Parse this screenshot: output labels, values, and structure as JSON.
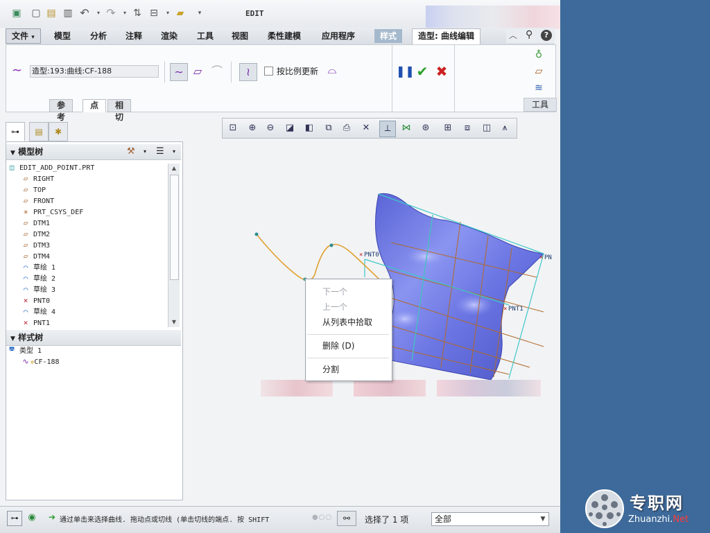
{
  "window": {
    "title": "EDIT"
  },
  "menu": {
    "tabs": [
      {
        "label": "文件",
        "dropdown": "▾"
      },
      {
        "label": "模型"
      },
      {
        "label": "分析"
      },
      {
        "label": "注释"
      },
      {
        "label": "渲染"
      },
      {
        "label": "工具"
      },
      {
        "label": "视图"
      },
      {
        "label": "柔性建模"
      },
      {
        "label": "应用程序"
      },
      {
        "label": "样式"
      },
      {
        "label": "造型: 曲线编辑"
      }
    ]
  },
  "ribbon": {
    "curve_name": "造型:193:曲线:CF-188",
    "proportional_update_label": "按比例更新",
    "subtabs": [
      "参考",
      "点",
      "相切"
    ],
    "tools_label": "工具"
  },
  "left_panel": {
    "model_tree_title": "模型树",
    "model_items": [
      {
        "icon": "part-icon",
        "label": "EDIT_ADD_POINT.PRT",
        "indent": 0
      },
      {
        "icon": "datum-plane-icon",
        "label": "RIGHT",
        "indent": 1
      },
      {
        "icon": "datum-plane-icon",
        "label": "TOP",
        "indent": 1
      },
      {
        "icon": "datum-plane-icon",
        "label": "FRONT",
        "indent": 1
      },
      {
        "icon": "csys-icon",
        "label": "PRT_CSYS_DEF",
        "indent": 1
      },
      {
        "icon": "datum-plane-icon",
        "label": "DTM1",
        "indent": 1
      },
      {
        "icon": "datum-plane-icon",
        "label": "DTM2",
        "indent": 1
      },
      {
        "icon": "datum-plane-icon",
        "label": "DTM3",
        "indent": 1
      },
      {
        "icon": "datum-plane-icon",
        "label": "DTM4",
        "indent": 1
      },
      {
        "icon": "sketch-icon",
        "label": "草绘 1",
        "indent": 1
      },
      {
        "icon": "sketch-icon",
        "label": "草绘 2",
        "indent": 1
      },
      {
        "icon": "sketch-icon",
        "label": "草绘 3",
        "indent": 1
      },
      {
        "icon": "datum-point-icon",
        "label": "PNT0",
        "indent": 1
      },
      {
        "icon": "sketch-icon",
        "label": "草绘 4",
        "indent": 1
      },
      {
        "icon": "datum-point-icon",
        "label": "PNT1",
        "indent": 1
      }
    ],
    "style_tree_title": "样式树",
    "style_items": [
      {
        "label": "类型 1"
      },
      {
        "label": "CF-188"
      }
    ]
  },
  "graphics": {
    "point_labels": [
      "PNT0",
      "PNT1",
      "PN"
    ],
    "context_menu": {
      "items": [
        {
          "label": "下一个",
          "disabled": true
        },
        {
          "label": "上一个",
          "disabled": true
        },
        {
          "label": "从列表中拾取",
          "disabled": false
        },
        {
          "label": "删除 (D)",
          "disabled": false
        },
        {
          "label": "分割",
          "disabled": false
        }
      ]
    }
  },
  "status_bar": {
    "message": "通过单击来选择曲线. 拖动点或切线 (单击切线的端点. 按 SHIFT",
    "selection_count": "选择了 1 项",
    "filter_value": "全部"
  },
  "logo": {
    "name": "专职网",
    "url_main": "Zhuanzhi.",
    "url_suffix": "Net"
  },
  "colors": {
    "surface": "#6e78e0",
    "curve": "#e0a030",
    "grid_orange": "#b06a2a",
    "grid_cyan": "#3ec8c8",
    "accept": "#2aa12a",
    "cancel": "#cc2222",
    "pause": "#2050b0"
  }
}
